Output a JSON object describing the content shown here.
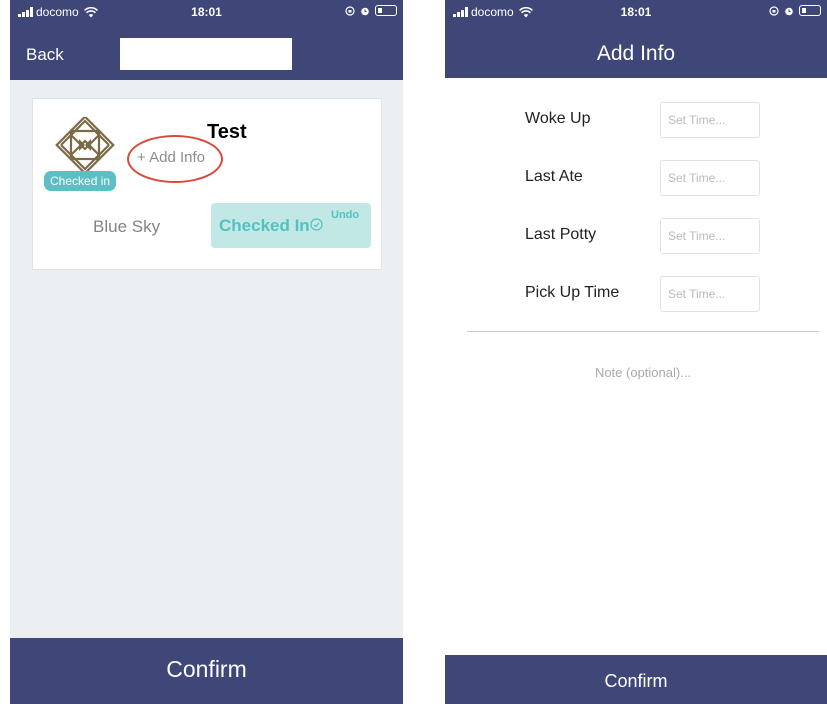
{
  "status_bar": {
    "carrier": "docomo",
    "time": "18:01"
  },
  "left_screen": {
    "header": {
      "back_label": "Back"
    },
    "card": {
      "child_name": "Test",
      "add_info_label": "+ Add Info",
      "status_badge": "Checked in",
      "room_name": "Blue Sky",
      "checked_in_label": "Checked In",
      "undo_label": "Undo"
    },
    "confirm_label": "Confirm"
  },
  "right_screen": {
    "header": {
      "title": "Add Info"
    },
    "fields": [
      {
        "label": "Woke Up",
        "placeholder": "Set Time..."
      },
      {
        "label": "Last Ate",
        "placeholder": "Set Time..."
      },
      {
        "label": "Last Potty",
        "placeholder": "Set Time..."
      },
      {
        "label": "Pick Up Time",
        "placeholder": "Set Time..."
      }
    ],
    "note_placeholder": "Note (optional)...",
    "confirm_label": "Confirm"
  },
  "colors": {
    "header_bg": "#3f4678",
    "accent_teal": "#5bc0c4",
    "highlight_ring": "#d9493c",
    "left_bg": "#ebeff2"
  },
  "icons": [
    "signal-icon",
    "wifi-icon",
    "lock-rotation-icon",
    "alarm-icon",
    "battery-icon",
    "check-circle-icon",
    "avatar-pattern-icon"
  ]
}
